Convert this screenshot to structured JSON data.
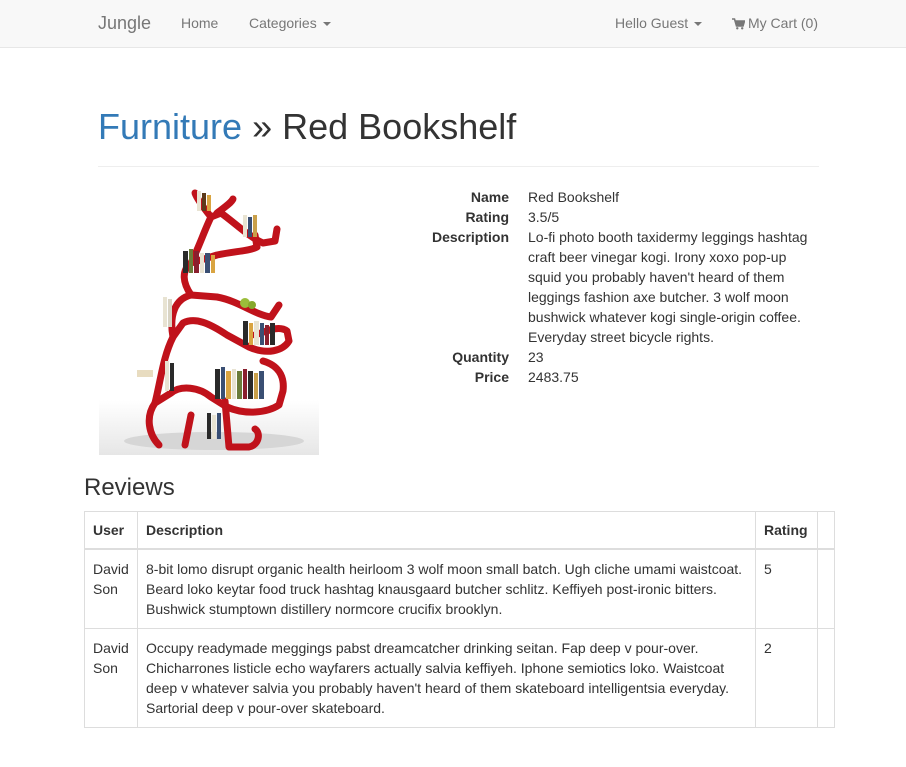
{
  "navbar": {
    "brand": "Jungle",
    "home": "Home",
    "categories": "Categories",
    "user_menu": "Hello Guest",
    "cart": "My Cart (0)"
  },
  "breadcrumb": {
    "category": "Furniture",
    "separator": "»",
    "product": "Red Bookshelf"
  },
  "product": {
    "labels": {
      "name": "Name",
      "rating": "Rating",
      "description": "Description",
      "quantity": "Quantity",
      "price": "Price"
    },
    "name": "Red Bookshelf",
    "rating": "3.5/5",
    "description": "Lo-fi photo booth taxidermy leggings hashtag craft beer vinegar kogi. Irony xoxo pop-up squid you probably haven't heard of them leggings fashion axe butcher. 3 wolf moon bushwick whatever kogi single-origin coffee. Everyday street bicycle rights.",
    "quantity": "23",
    "price": "2483.75",
    "image_icon": "red-bookshelf-image",
    "accent_color": "#c0121b"
  },
  "reviews": {
    "heading": "Reviews",
    "columns": {
      "user": "User",
      "description": "Description",
      "rating": "Rating"
    },
    "rows": [
      {
        "user": "David Son",
        "description": "8-bit lomo disrupt organic health heirloom 3 wolf moon small batch. Ugh cliche umami waistcoat. Beard loko keytar food truck hashtag knausgaard butcher schlitz. Keffiyeh post-ironic bitters. Bushwick stumptown distillery normcore crucifix brooklyn.",
        "rating": "5"
      },
      {
        "user": "David Son",
        "description": "Occupy readymade meggings pabst dreamcatcher drinking seitan. Fap deep v pour-over. Chicharrones listicle echo wayfarers actually salvia keffiyeh. Iphone semiotics loko. Waistcoat deep v whatever salvia you probably haven't heard of them skateboard intelligentsia everyday. Sartorial deep v pour-over skateboard.",
        "rating": "2"
      }
    ]
  },
  "colors": {
    "link": "#337ab7",
    "navbar_bg": "#f8f8f8",
    "text": "#333333",
    "nav_text": "#777777"
  }
}
